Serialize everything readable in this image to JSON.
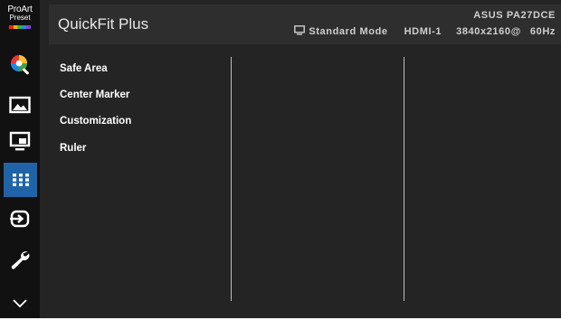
{
  "brand": {
    "line1": "ProArt",
    "line2": "Preset"
  },
  "header": {
    "title": "QuickFit Plus",
    "model": "ASUS PA27DCE",
    "mode": "Standard Mode",
    "input": "HDMI-1",
    "resolution": "3840x2160@",
    "refresh": "60Hz"
  },
  "menu": {
    "items": [
      {
        "label": "Safe Area"
      },
      {
        "label": "Center Marker"
      },
      {
        "label": "Customization"
      },
      {
        "label": "Ruler"
      }
    ]
  },
  "sidebar": {
    "icons": [
      "proart-preset-logo",
      "color-icon",
      "image-icon",
      "pip-pbp-icon",
      "quickfit-icon",
      "input-select-icon",
      "system-setup-icon",
      "scroll-down-icon"
    ],
    "active": "quickfit-icon"
  },
  "colors": {
    "background": "#242424",
    "header": "#2e2e2e",
    "rail": "#111111",
    "active_accent": "#1f63a8",
    "text": "#ffffff"
  }
}
